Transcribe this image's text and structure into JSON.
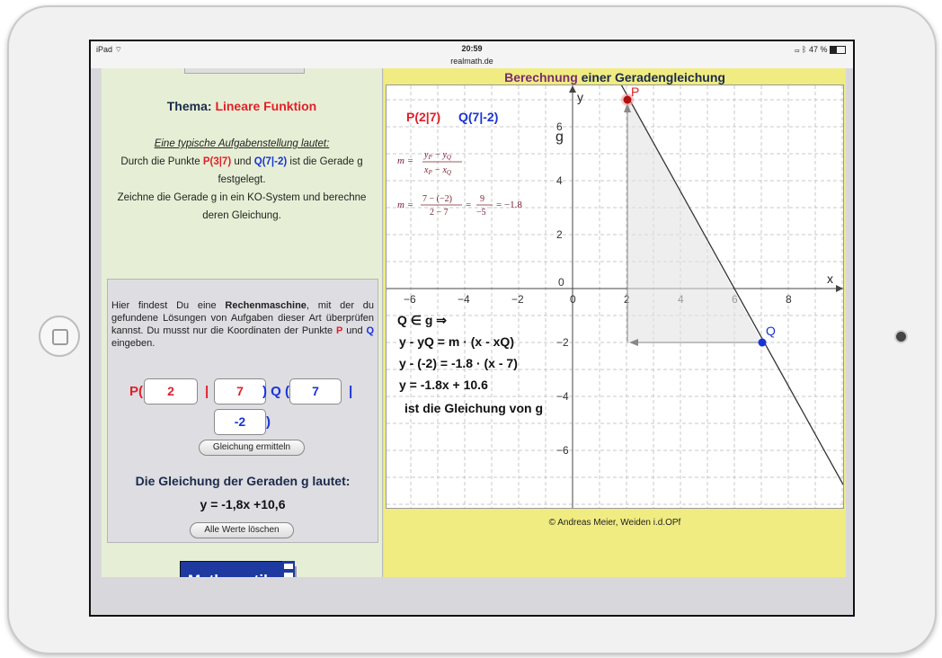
{
  "status": {
    "device": "iPad",
    "wifi_icon": "wifi-icon",
    "time": "20:59",
    "url": "realmath.de",
    "battery": "47 %"
  },
  "left": {
    "thema_label": "Thema:",
    "thema_value": "Lineare Funktion",
    "task_heading": "Eine typische Aufgabenstellung lautet:",
    "task_line1_a": "Durch die Punkte",
    "task_p": "P(3|7)",
    "task_und": "und",
    "task_q": "Q(7|-2)",
    "task_line1_b": "ist die Gerade g festgelegt.",
    "task_line2": "Zeichne die Gerade g in ein KO-System und berechne deren Gleichung.",
    "intro_a": "Hier findest Du eine",
    "intro_bold": "Rechenmaschine",
    "intro_b": ", mit der du gefundene Lösungen von Aufgaben dieser Art überprüfen kannst. Du musst nur die Koordinaten der Punkte",
    "intro_p": "P",
    "intro_und": "und",
    "intro_q": "Q",
    "intro_c": "eingeben.",
    "p_open": "P(",
    "px": "2",
    "sep1": "|",
    "py": "7",
    "q_open": ") Q (",
    "qx": "7",
    "sep2": "|",
    "qy": "-2",
    "close": ")",
    "btn_calc": "Gleichung ermitteln",
    "result_title": "Die Gleichung der Geraden g lautet:",
    "result": "y = -1,8x +10,6",
    "btn_clear": "Alle Werte löschen",
    "logo": "Mathematik"
  },
  "right": {
    "title_a": "Berechnung",
    "title_b": "einer Geradengleichung",
    "p_label": "P(2|7)",
    "q_label": "Q(7|-2)",
    "m_formula": "m = (yP − yQ)/(xP − xQ)",
    "m_calc_num": "7 − (−2)",
    "m_calc_den": "2 − 7",
    "m_frac_num": "9",
    "m_frac_den": "−5",
    "m_result": "= −1.8",
    "line1": "Q ∈ g  ⇒",
    "line2": "y - yQ = m · (x - xQ)",
    "line3": "y - (-2) = -1.8 · (x - 7)",
    "line4": "y = -1.8x + 10.6",
    "line5": "ist die Gleichung von g",
    "axis_x": "x",
    "axis_y": "y",
    "line_label": "g",
    "pt_p": "P",
    "pt_q": "Q",
    "xticks": [
      "−6",
      "−4",
      "−2",
      "0",
      "2",
      "4",
      "6",
      "8"
    ],
    "yticks": [
      "6",
      "4",
      "2",
      "0",
      "−2",
      "−4",
      "−6"
    ],
    "copyright": "© Andreas Meier, Weiden i.d.OPf"
  },
  "colors": {
    "red": "#e0202a",
    "blue": "#1a33d8",
    "purple": "#7a2c6e",
    "panel_green": "#e6efd5",
    "panel_yellow": "#f0ec82"
  }
}
